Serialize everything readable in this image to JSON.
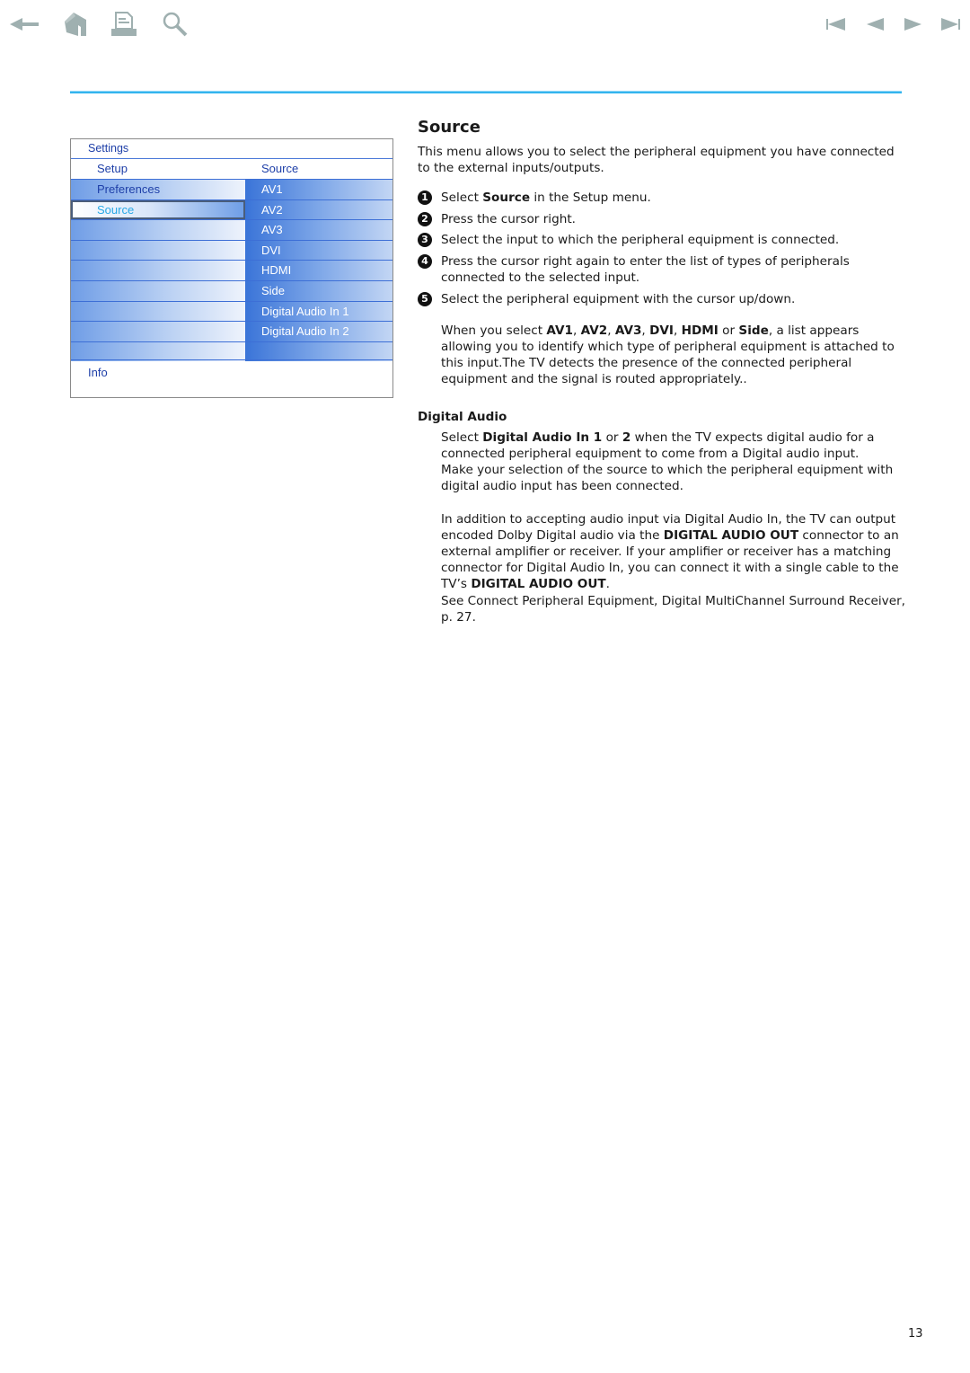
{
  "nav": {
    "left_icons": [
      "back-arrow-icon",
      "home-icon",
      "print-icon",
      "search-icon"
    ],
    "right_icons": [
      "first-page-icon",
      "previous-page-icon",
      "next-page-icon",
      "last-page-icon"
    ],
    "icon_color": "#9fb0b0"
  },
  "accent_color": "#33b4ee",
  "menu": {
    "title": "Settings",
    "left_header": "Setup",
    "right_header": "Source",
    "left_items": [
      "Preferences",
      "Source",
      "",
      "",
      "",
      "",
      "",
      ""
    ],
    "selected_left_index": 1,
    "right_items": [
      "AV1",
      "AV2",
      "AV3",
      "DVI",
      "HDMI",
      "Side",
      "Digital Audio In 1",
      "Digital Audio In 2"
    ],
    "info_label": "Info"
  },
  "content": {
    "title": "Source",
    "intro": "This menu allows you to select the peripheral equipment you have connected to the external inputs/outputs.",
    "steps": [
      {
        "num": "1",
        "pre": "Select ",
        "bold": "Source",
        "post": " in the Setup menu."
      },
      {
        "num": "2",
        "text": "Press the cursor right."
      },
      {
        "num": "3",
        "text": "Select the input to which the peripheral equipment is connected."
      },
      {
        "num": "4",
        "text": "Press the cursor right again to enter the list of types of peripherals connected to the selected input."
      },
      {
        "num": "5",
        "text": "Select the peripheral equipment with the cursor up/down."
      }
    ],
    "note": {
      "pre": "When you select ",
      "b1": "AV1",
      "s1": ", ",
      "b2": "AV2",
      "s2": ", ",
      "b3": "AV3",
      "s3": ", ",
      "b4": "DVI",
      "s4": ", ",
      "b5": "HDMI",
      "s5": " or ",
      "b6": "Side",
      "post": ", a list appears allowing you to identify which type of peripheral equipment is attached to this input.The TV detects the presence of the connected peripheral equipment and the signal is routed appropriately.."
    },
    "digital_audio": {
      "heading": "Digital Audio",
      "p1_pre": "Select ",
      "p1_b1": "Digital Audio In 1",
      "p1_mid": " or ",
      "p1_b2": "2",
      "p1_post": " when the TV expects digital audio for a connected peripheral equipment to come from a Digital audio input.",
      "p2": "Make your selection of the source to which the peripheral equipment with digital audio input has been connected.",
      "p3_pre": "In addition to accepting audio input via Digital Audio In, the TV can output encoded Dolby Digital audio via the ",
      "p3_b1": "DIGITAL AUDIO OUT",
      "p3_mid": " connector to an external amplifier or receiver. If your amplifier or receiver has a matching connector for Digital Audio In, you can connect it with a single cable to the TV’s ",
      "p3_b2": "DIGITAL AUDIO OUT",
      "p3_post": ".",
      "p4": "See Connect Peripheral Equipment, Digital MultiChannel Surround Receiver, p. 27."
    }
  },
  "page_number": "13"
}
